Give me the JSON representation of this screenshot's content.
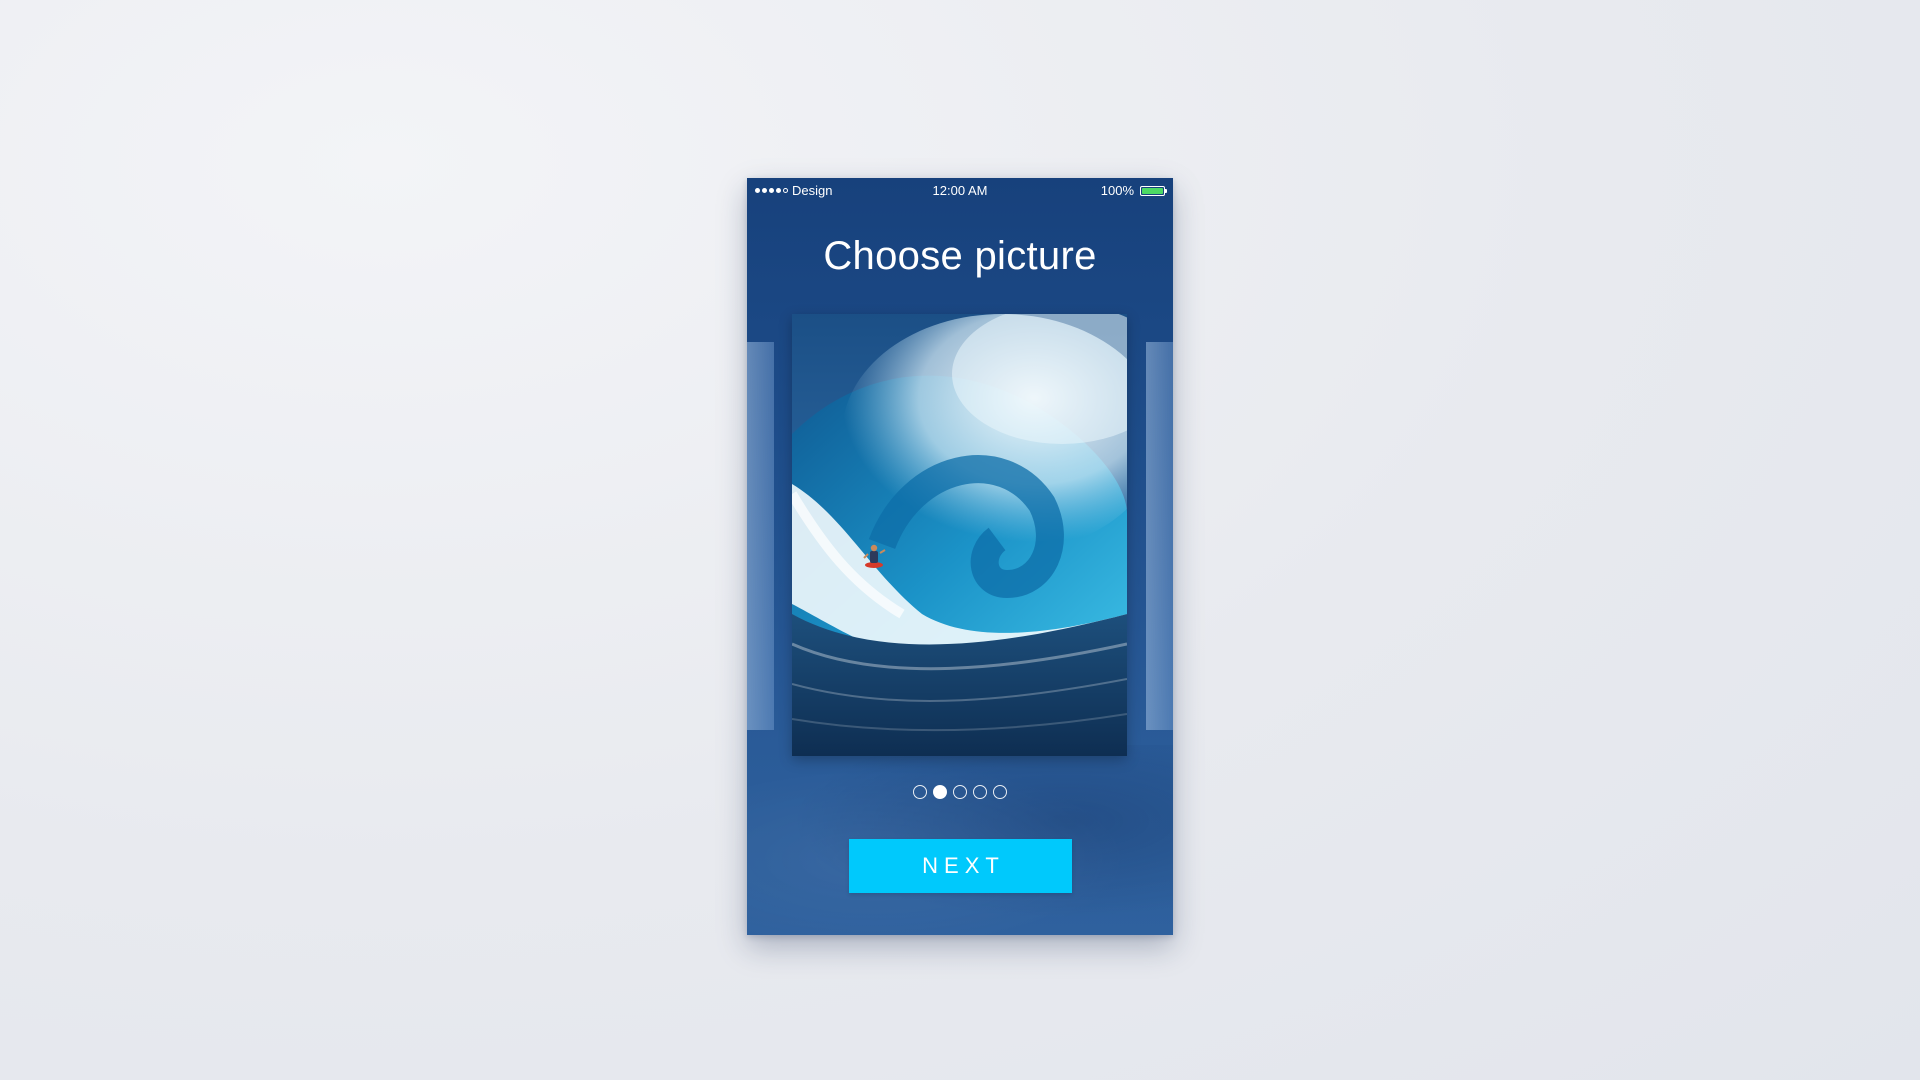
{
  "status_bar": {
    "carrier": "Design",
    "time": "12:00 AM",
    "battery": "100%",
    "battery_color": "#4cd964",
    "signal_strength_of_5": 4
  },
  "screen": {
    "title": "Choose picture",
    "image_icon": "surfer-wave-photo",
    "pagination": {
      "total": 5,
      "active_index": 1
    },
    "next_label": "NEXT",
    "accent_color": "#00c9fc"
  }
}
